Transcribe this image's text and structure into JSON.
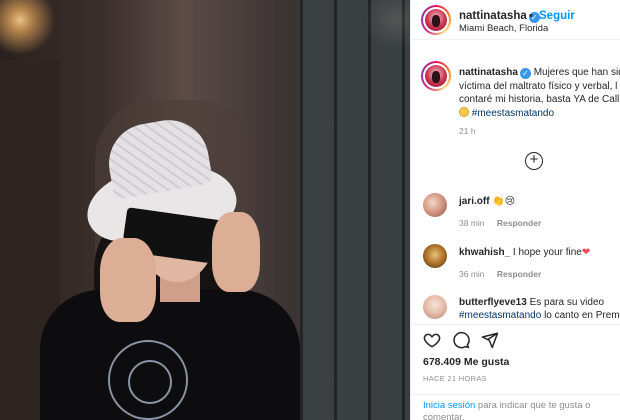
{
  "post": {
    "username": "nattinatasha",
    "follow_label": "Seguir",
    "location": "Miami Beach, Florida",
    "separator": "•"
  },
  "caption": {
    "username": "nattinatasha",
    "line1": "Mujeres que han sid",
    "line2": "víctima del maltrato físico y verbal, l",
    "line3": "contaré mi historia, basta YA de Call",
    "hashtag": "#meestasmatando",
    "time": "21 h"
  },
  "comments": [
    {
      "username": "jari.off",
      "text": "👏😢",
      "time": "38 min",
      "reply": "Responder"
    },
    {
      "username": "khwahish_",
      "text": "I hope your fine",
      "heart": "❤",
      "time": "36 min",
      "reply": "Responder"
    },
    {
      "username": "butterflyeve13",
      "text": "Es para su video",
      "hashtag": "#meestasmatando",
      "text2": "lo canto en Prem"
    }
  ],
  "actions": {
    "like_icon": "heart-outline-icon",
    "comment_icon": "comment-bubble-icon",
    "share_icon": "paper-plane-icon"
  },
  "likes": "678.409 Me gusta",
  "posted_ago": "HACE 21 HORAS",
  "login": {
    "link": "Inicia sesión",
    "text": "para indicar que te gusta o",
    "text2": "comentar."
  },
  "colors": {
    "link_blue": "#0095f6",
    "verified_blue": "#3897f0",
    "hashtag": "#00376b",
    "muted": "#8e8e8e"
  }
}
